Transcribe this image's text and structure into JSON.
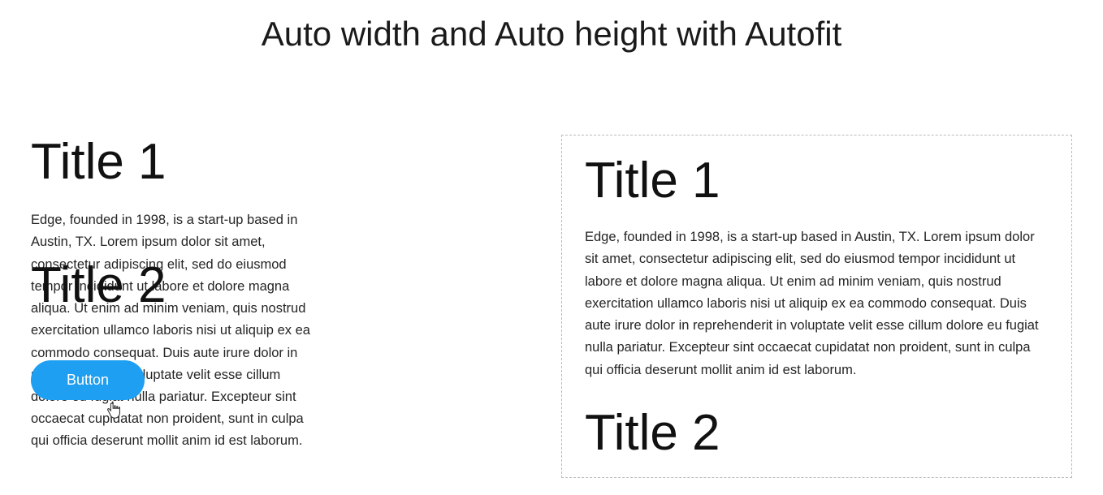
{
  "page": {
    "title": "Auto width and Auto height with Autofit"
  },
  "left": {
    "title1": "Title 1",
    "body": "Edge, founded in 1998, is a start-up based in Austin, TX. Lorem ipsum dolor sit amet, consectetur adipiscing elit, sed do eiusmod tempor incididunt ut labore et dolore magna aliqua. Ut enim ad minim veniam, quis nostrud exercitation ullamco laboris nisi ut aliquip ex ea commodo consequat. Duis aute irure dolor in reprehenderit in voluptate velit esse cillum dolore eu fugiat nulla pariatur. Excepteur sint occaecat cupidatat non proident, sunt in culpa qui officia deserunt mollit anim id est laborum.",
    "title2": "Title 2",
    "button_label": "Button"
  },
  "right": {
    "title1": "Title 1",
    "body": "Edge, founded in 1998, is a start-up based in Austin, TX. Lorem ipsum dolor sit amet, consectetur adipiscing elit, sed do eiusmod tempor incididunt ut labore et dolore magna aliqua. Ut enim ad minim veniam, quis nostrud exercitation ullamco laboris nisi ut aliquip ex ea commodo consequat. Duis aute irure dolor in reprehenderit in voluptate velit esse cillum dolore eu fugiat nulla pariatur. Excepteur sint occaecat cupidatat non proident, sunt in culpa qui officia deserunt mollit anim id est laborum.",
    "title2": "Title 2"
  }
}
